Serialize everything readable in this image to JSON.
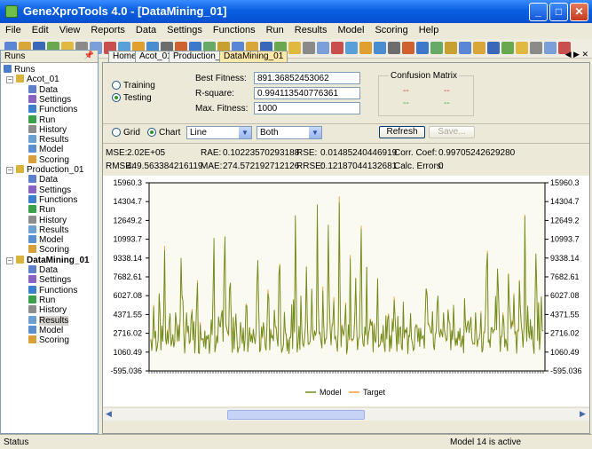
{
  "window": {
    "title": "GeneXproTools 4.0 - [DataMining_01]"
  },
  "menu": [
    "File",
    "Edit",
    "View",
    "Reports",
    "Data",
    "Settings",
    "Functions",
    "Run",
    "Results",
    "Model",
    "Scoring",
    "Help"
  ],
  "sidebar": {
    "header": "Runs",
    "root": "Runs",
    "runs": [
      {
        "name": "Acot_01",
        "children": [
          "Data",
          "Settings",
          "Functions",
          "Run",
          "History",
          "Results",
          "Model",
          "Scoring"
        ]
      },
      {
        "name": "Production_01",
        "children": [
          "Data",
          "Settings",
          "Functions",
          "Run",
          "History",
          "Results",
          "Model",
          "Scoring"
        ]
      },
      {
        "name": "DataMining_01",
        "children": [
          "Data",
          "Settings",
          "Functions",
          "Run",
          "History",
          "Results",
          "Model",
          "Scoring"
        ]
      }
    ],
    "selected": "Results"
  },
  "tabs": [
    "Home",
    "Acot_01",
    "Production_01",
    "DataMining_01"
  ],
  "active_tab": "DataMining_01",
  "mode": {
    "training": "Training",
    "testing": "Testing",
    "selected": "Testing"
  },
  "fitness": {
    "best_label": "Best Fitness:",
    "best_value": "891.36852453062",
    "rsq_label": "R-square:",
    "rsq_value": "0.994113540776361",
    "max_label": "Max. Fitness:",
    "max_value": "1000"
  },
  "confusion": {
    "title": "Confusion Matrix",
    "cells": [
      "--",
      "--",
      "--",
      "--"
    ]
  },
  "view": {
    "grid": "Grid",
    "chart": "Chart",
    "selected": "Chart",
    "chart_type": "Line",
    "series": "Both",
    "refresh": "Refresh",
    "save": "Save..."
  },
  "stats": {
    "mse_label": "MSE:",
    "mse": "2.02E+05",
    "rae_label": "RAE:",
    "rae": "0.10223570293188",
    "rse_label": "RSE:",
    "rse": "0.01485240446919",
    "corr_label": "Corr. Coef:",
    "corr": "0.99705242629280",
    "rmse_label": "RMSE:",
    "rmse": "449.563384216119",
    "mae_label": "MAE:",
    "mae": "274.572192712126",
    "rrse_label": "RRSE:",
    "rrse": "0.12187044132681",
    "calc_label": "Calc. Errors:",
    "calc": "0"
  },
  "chart_data": {
    "type": "line",
    "ylim": [
      -595.036,
      15960.3
    ],
    "yticks": [
      "15960.3",
      "14304.7",
      "12649.2",
      "10993.7",
      "9338.14",
      "7682.61",
      "6027.08",
      "4371.55",
      "2716.02",
      "1060.49",
      "-595.036"
    ],
    "series": [
      {
        "name": "Model",
        "color": "#6B8E23"
      },
      {
        "name": "Target",
        "color": "#F2A03D"
      }
    ],
    "peaks": [
      4200,
      6200,
      9800,
      3400,
      4900,
      11300,
      5100,
      3800,
      7100,
      3500,
      2600,
      12800,
      4100,
      13600,
      9500,
      5400,
      2400,
      7600,
      3100,
      10800,
      2900,
      8700,
      3300,
      11800,
      5200,
      3600,
      14600,
      6100,
      10200,
      4800,
      15600,
      7400,
      12400,
      5900,
      14400,
      4300,
      9000,
      6500,
      13200,
      5500,
      3200,
      8900,
      4700,
      5300,
      2800,
      3900,
      2500,
      3700,
      5600,
      2300,
      9400,
      3800,
      6700,
      4100,
      2700,
      5000,
      3000,
      6300,
      2600,
      3800,
      2200,
      11800,
      4500,
      10600,
      3100,
      8200,
      5400,
      6600,
      12100,
      3600,
      9300,
      4800
    ]
  },
  "status": {
    "left": "Status",
    "right": "Model 14 is active"
  }
}
